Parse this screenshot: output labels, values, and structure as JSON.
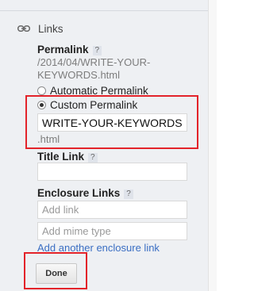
{
  "links_section": {
    "label": "Links"
  },
  "permalink": {
    "heading": "Permalink",
    "help": "?",
    "current_path_line1": "/2014/04/WRITE-YOUR-",
    "current_path_line2": "KEYWORDS.html",
    "options": [
      {
        "label": "Automatic Permalink",
        "selected": false
      },
      {
        "label": "Custom Permalink",
        "selected": true
      }
    ],
    "custom_value": "WRITE-YOUR-KEYWORDS",
    "suffix": ".html"
  },
  "title_link": {
    "heading": "Title Link",
    "help": "?",
    "value": ""
  },
  "enclosure_links": {
    "heading": "Enclosure Links",
    "help": "?",
    "link_placeholder": "Add link",
    "mime_placeholder": "Add mime type",
    "add_another_label": "Add another enclosure link"
  },
  "done_button": {
    "label": "Done"
  },
  "colors": {
    "highlight": "#e3232a",
    "link": "#3a6ec3",
    "panel": "#eef0f3"
  }
}
